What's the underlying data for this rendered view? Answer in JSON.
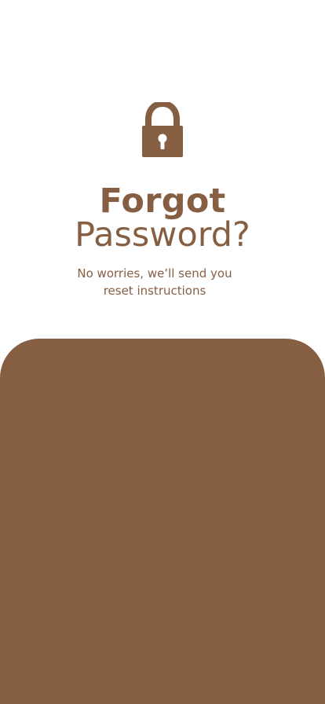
{
  "header": {
    "title_line_1": "Forgot",
    "title_line_2": "Password?",
    "subtitle": "No worries, we’ll send you reset instructions"
  },
  "icons": {
    "lock": "lock-icon"
  },
  "colors": {
    "accent": "#865f43",
    "background": "#ffffff"
  }
}
